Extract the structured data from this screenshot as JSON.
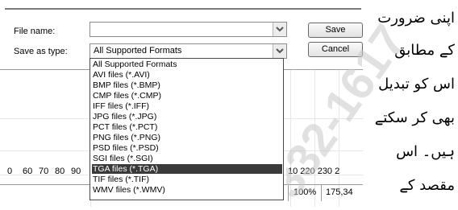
{
  "dialog": {
    "file_name_label": "File name:",
    "file_name_value": "",
    "save_as_label": "Save as type:",
    "save_as_value": "All Supported Formats",
    "save_button": "Save",
    "cancel_button": "Cancel"
  },
  "dropdown": {
    "items": [
      "All Supported Formats",
      "AVI files (*.AVI)",
      "BMP files (*.BMP)",
      "CMP files (*.CMP)",
      "IFF files (*.IFF)",
      "JPG files (*.JPG)",
      "PCT files (*.PCT)",
      "PNG files (*.PNG)",
      "PSD files (*.PSD)",
      "SGI files (*.SGI)",
      "TGA files (*.TGA)",
      "TIF files (*.TIF)",
      "WMV files (*.WMV)"
    ],
    "selected": "TGA files (*.TGA)"
  },
  "ruler": {
    "left_ticks": [
      "0",
      "60",
      "70",
      "80",
      "90"
    ],
    "right_ticks": "10 220 230 2"
  },
  "status": {
    "zoom": "100%",
    "coords": "175,34"
  },
  "urdu_text": {
    "lines": [
      "اپنی ضرورت",
      "کے مطابق",
      "اس کو تبدیل",
      "بھی کر سکتے",
      "ہیں۔ اس",
      "مقصد کے"
    ]
  },
  "watermark": "332-1617",
  "colors": {
    "selection_bg": "#3a3a3a",
    "selection_fg": "#ffffff",
    "watermark": "#c8c8c8"
  }
}
